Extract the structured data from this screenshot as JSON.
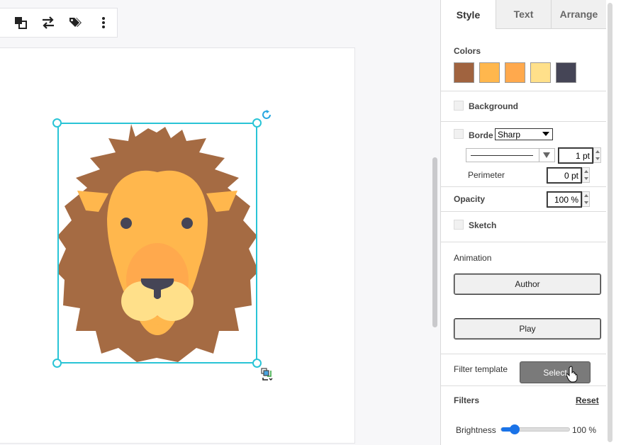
{
  "toolbar": {
    "icons": [
      "arrange-icon",
      "swap-icon",
      "tags-icon",
      "more-vertical-icon"
    ]
  },
  "tabs": [
    {
      "label": "Style",
      "active": true
    },
    {
      "label": "Text",
      "active": false
    },
    {
      "label": "Arrange",
      "active": false
    }
  ],
  "style": {
    "colors_label": "Colors",
    "swatches": [
      "#A0633F",
      "#FFB74D",
      "#FFA94D",
      "#FFE08A",
      "#454556"
    ],
    "background_label": "Background",
    "border_label": "Borde",
    "border_style": "Sharp",
    "border_width": "1 pt",
    "perimeter_label": "Perimeter",
    "perimeter_value": "0 pt",
    "opacity_label": "Opacity",
    "opacity_value": "100 %",
    "sketch_label": "Sketch",
    "animation_label": "Animation",
    "author_button": "Author",
    "play_button": "Play",
    "filter_template_label": "Filter template",
    "select_button": "Select",
    "filters_label": "Filters",
    "reset_link": "Reset",
    "brightness_label": "Brightness",
    "brightness_value": "100 %",
    "brightness_fraction": 0.2
  },
  "colors": {
    "selection": "#29C4D6",
    "lion_mane": "#A56B43",
    "lion_face": "#FFB74D",
    "lion_muzzle": "#FFA94D",
    "lion_cheeks": "#FFE08A",
    "lion_features": "#454556"
  }
}
